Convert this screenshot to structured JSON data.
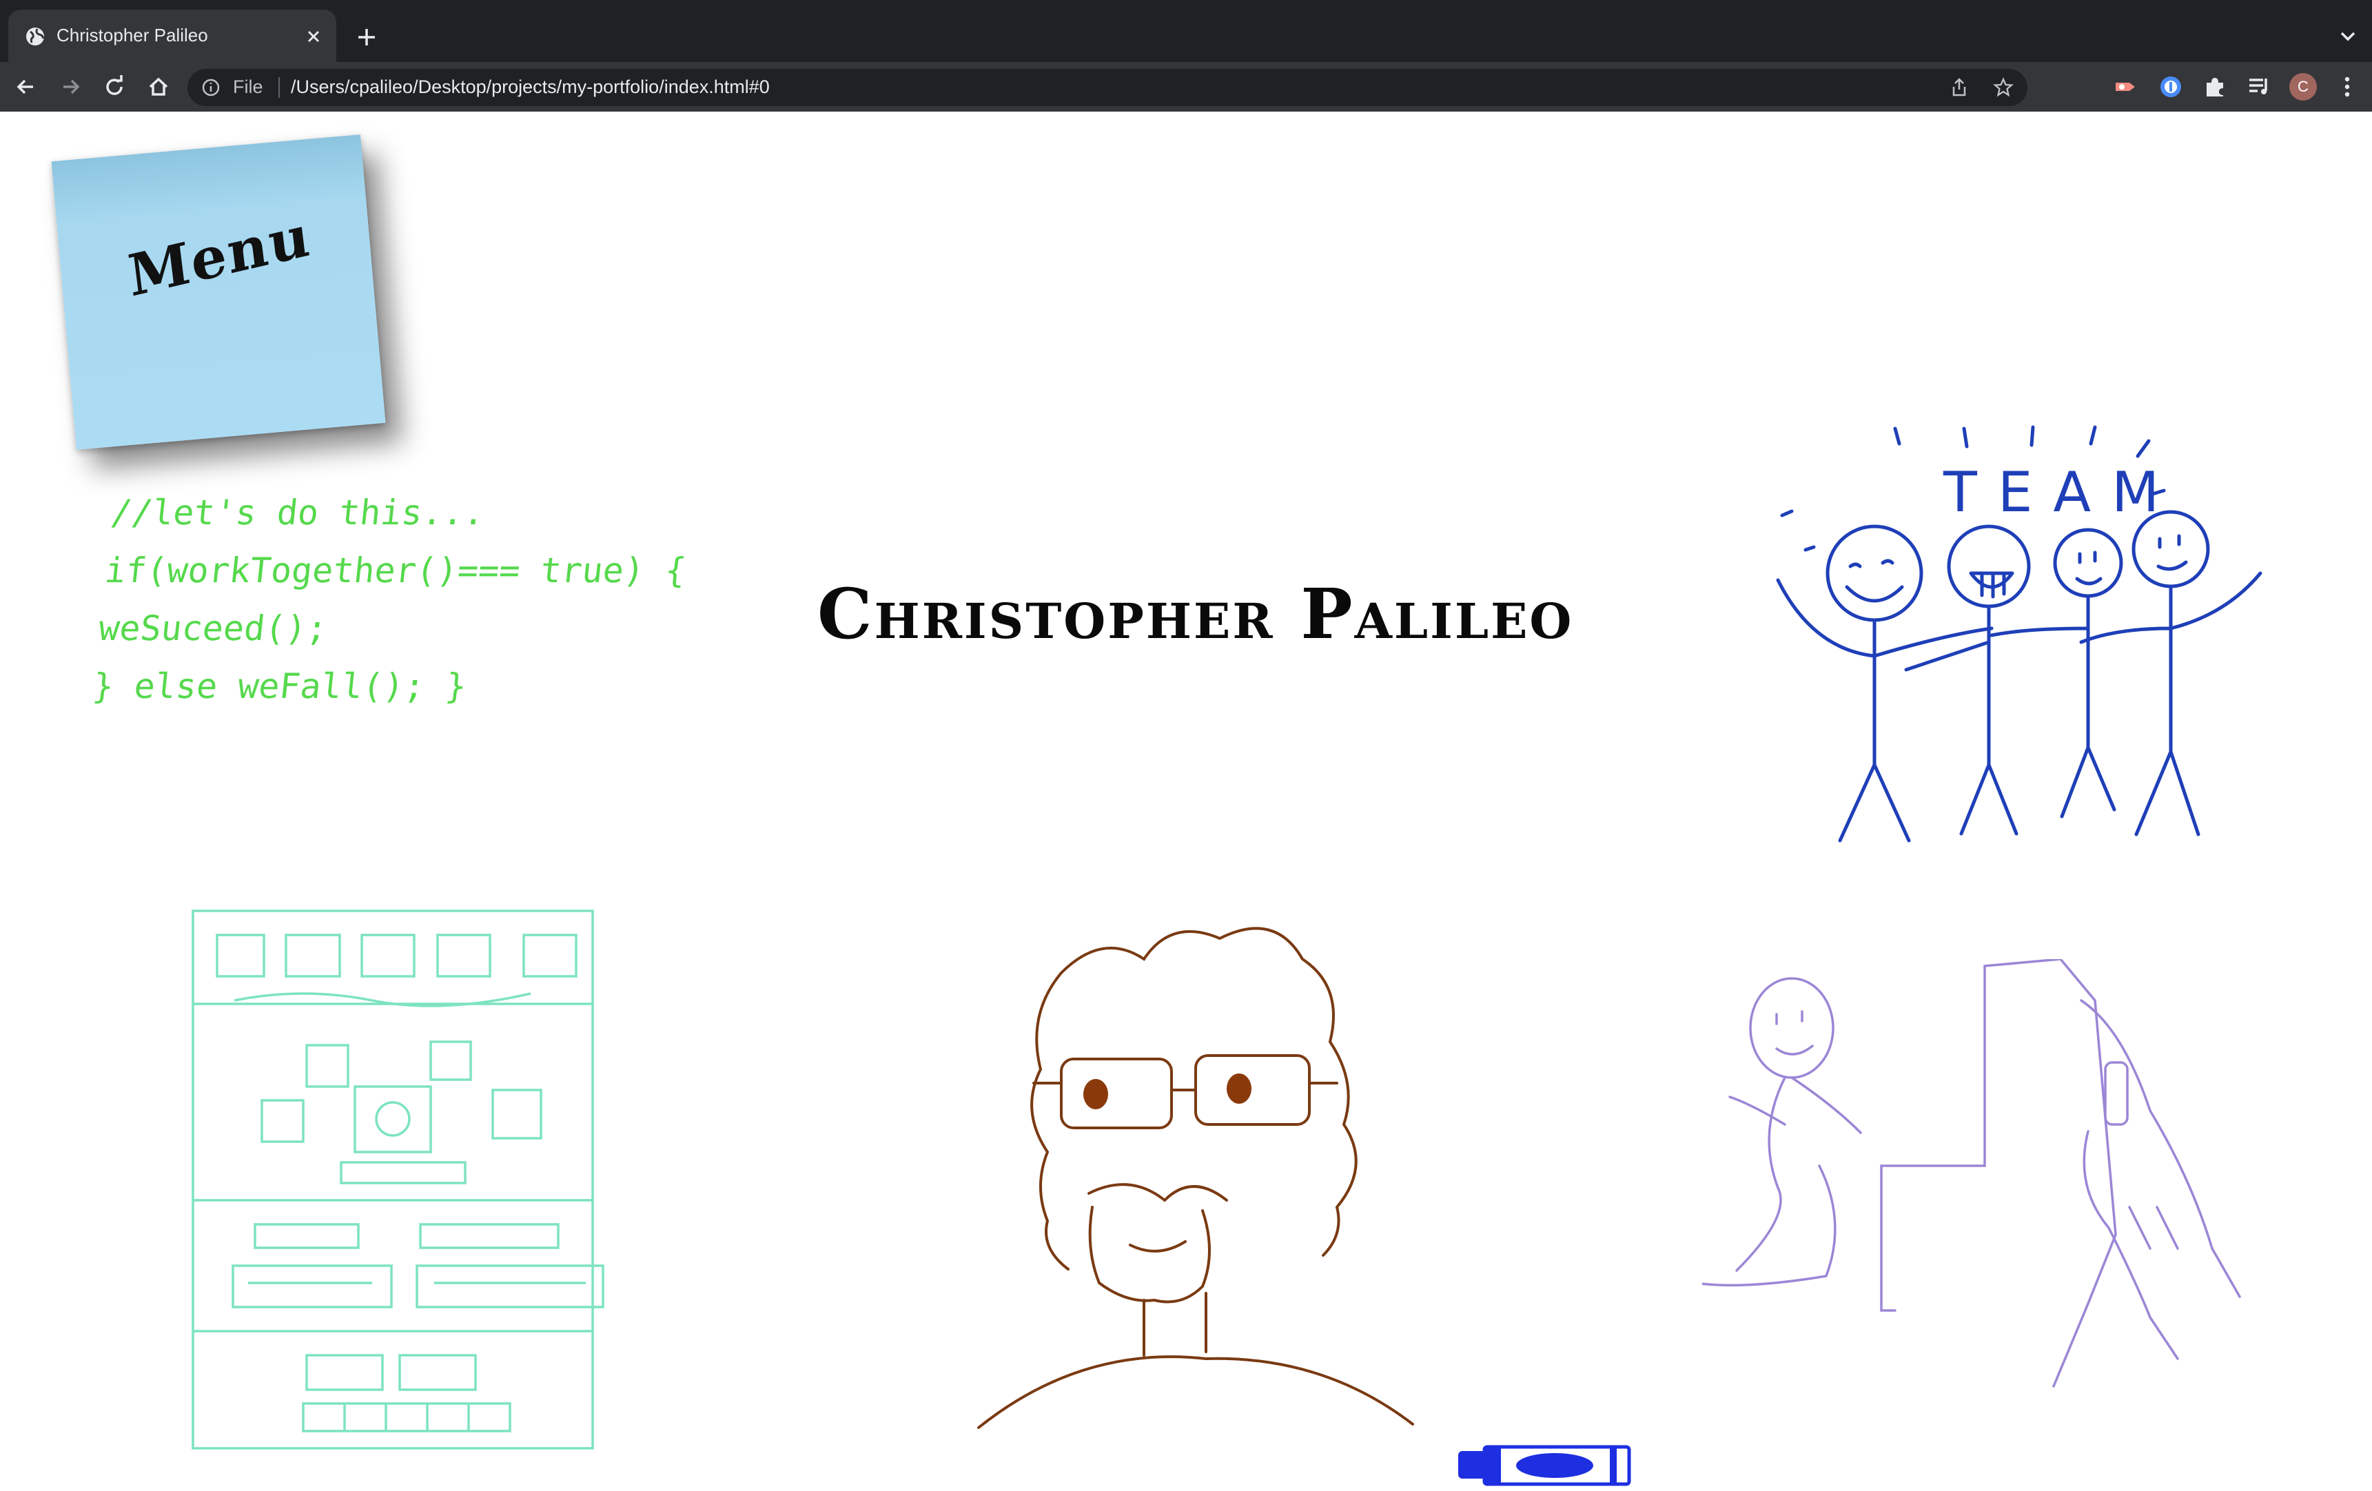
{
  "browser": {
    "tab_title": "Christopher Palileo",
    "url_scheme": "File",
    "url": "/Users/cpalileo/Desktop/projects/my-portfolio/index.html#0",
    "profile_initial": "C"
  },
  "page": {
    "menu_label": "Menu",
    "code_lines": [
      "//let's do this...",
      "if(workTogether()=== true) {",
      "weSuceed();",
      "} else weFall(); }"
    ],
    "name": "Christopher Palileo",
    "team_label": "TEAM"
  },
  "colors": {
    "sticky_note": "#acdcf4",
    "code_text": "#55d94c",
    "team_drawing": "#1f3fb8",
    "wireframe_drawing": "#7de3c2",
    "portrait_drawing": "#7a3a12",
    "creator_drawing": "#9b86d6",
    "marker": "#1d2fe0"
  },
  "icons": [
    "globe-icon",
    "close-icon",
    "plus-icon",
    "chevron-down-icon",
    "back-icon",
    "forward-icon",
    "reload-icon",
    "home-icon",
    "info-icon",
    "share-icon",
    "star-icon",
    "extension-icon",
    "password-icon",
    "puzzle-icon",
    "media-icon",
    "menu-dots-icon",
    "marker-icon"
  ]
}
